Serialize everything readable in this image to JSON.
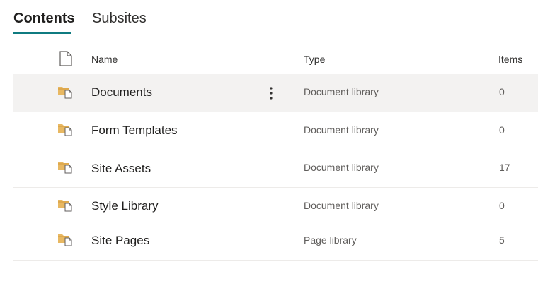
{
  "tabs": [
    {
      "label": "Contents",
      "active": true
    },
    {
      "label": "Subsites",
      "active": false
    }
  ],
  "columns": {
    "icon": "file-icon",
    "name": "Name",
    "type": "Type",
    "items": "Items"
  },
  "rows": [
    {
      "name": "Documents",
      "type": "Document library",
      "items": "0",
      "selected": true,
      "icon": "document-library-icon"
    },
    {
      "name": "Form Templates",
      "type": "Document library",
      "items": "0",
      "selected": false,
      "icon": "document-library-icon"
    },
    {
      "name": "Site Assets",
      "type": "Document library",
      "items": "17",
      "selected": false,
      "icon": "document-library-icon"
    },
    {
      "name": "Style Library",
      "type": "Document library",
      "items": "0",
      "selected": false,
      "icon": "document-library-icon"
    },
    {
      "name": "Site Pages",
      "type": "Page library",
      "items": "5",
      "selected": false,
      "icon": "page-library-icon"
    }
  ],
  "colors": {
    "accent": "#0f7b80",
    "selected_row": "#f3f2f1",
    "folder": "#e8b862"
  }
}
